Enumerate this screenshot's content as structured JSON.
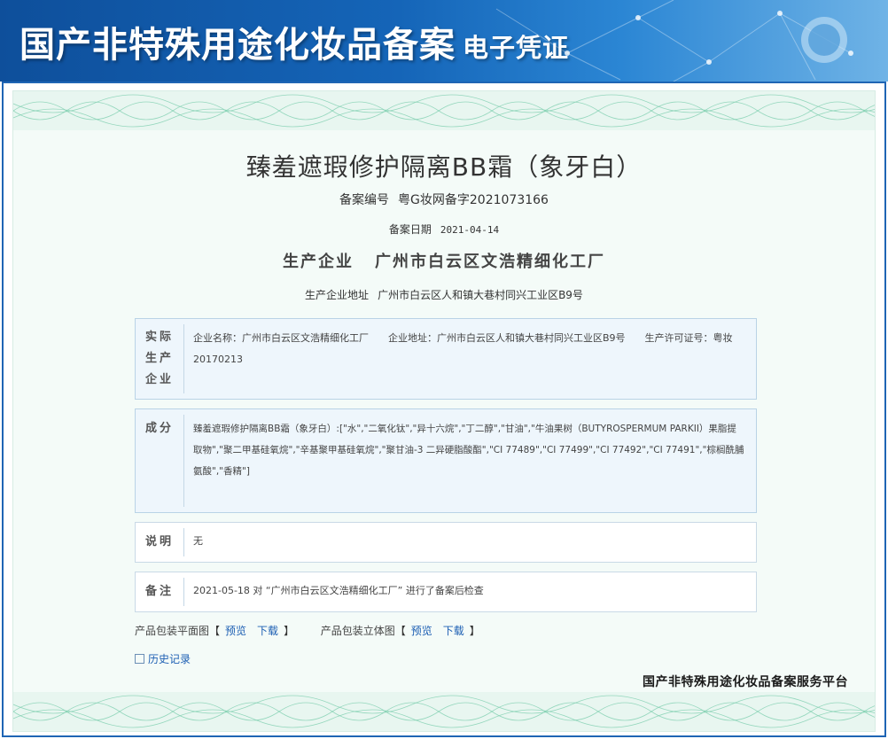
{
  "header": {
    "title": "国产非特殊用途化妆品备案",
    "subtitle": "电子凭证"
  },
  "product": {
    "name": "臻羞遮瑕修护隔离BB霜（象牙白）",
    "registration_label": "备案编号",
    "registration_no": "粤G妆网备字2021073166",
    "date_label": "备案日期",
    "date": "2021-04-14",
    "producer_label": "生产企业",
    "producer": "广州市白云区文浩精细化工厂",
    "address_label": "生产企业地址",
    "address": "广州市白云区人和镇大巷村同兴工业区B9号"
  },
  "actual_producer": {
    "header": "实际生产企业",
    "name_text": "企业名称：广州市白云区文浩精细化工厂",
    "address_text": "企业地址：广州市白云区人和镇大巷村同兴工业区B9号",
    "license_text": "生产许可证号：粤妆20170213"
  },
  "ingredients": {
    "header": "成分",
    "text": "臻羞遮瑕修护隔离BB霜（象牙白）:[\"水\",\"二氧化钛\",\"异十六烷\",\"丁二醇\",\"甘油\",\"牛油果树（BUTYROSPERMUM PARKII）果脂提取物\",\"聚二甲基硅氧烷\",\"辛基聚甲基硅氧烷\",\"聚甘油-3 二异硬脂酸酯\",\"CI 77489\",\"CI 77499\",\"CI 77492\",\"CI 77491\",\"棕榈酰脯氨酸\",\"香精\"]"
  },
  "notes": {
    "header": "说明",
    "text": "无"
  },
  "remarks": {
    "header": "备注",
    "text": "2021-05-18 对 “广州市白云区文浩精细化工厂” 进行了备案后检查"
  },
  "links": {
    "flat_label": "产品包装平面图",
    "flat_preview": "预览",
    "flat_download": "下载",
    "solid_label": "产品包装立体图",
    "solid_preview": "预览",
    "solid_download": "下载",
    "bracket_open": "【",
    "bracket_close": "】"
  },
  "history": {
    "label": "历史记录",
    "icon": "history-icon"
  },
  "footer": {
    "brand": "国产非特殊用途化妆品备案服务平台"
  },
  "colors": {
    "banner": "#1565b8",
    "frame_border": "#1f65b4",
    "panel_bg": "#f4fbf8",
    "box_bg": "#eef6fc",
    "link": "#1d5fb3",
    "wave": "#7fd0b0"
  }
}
